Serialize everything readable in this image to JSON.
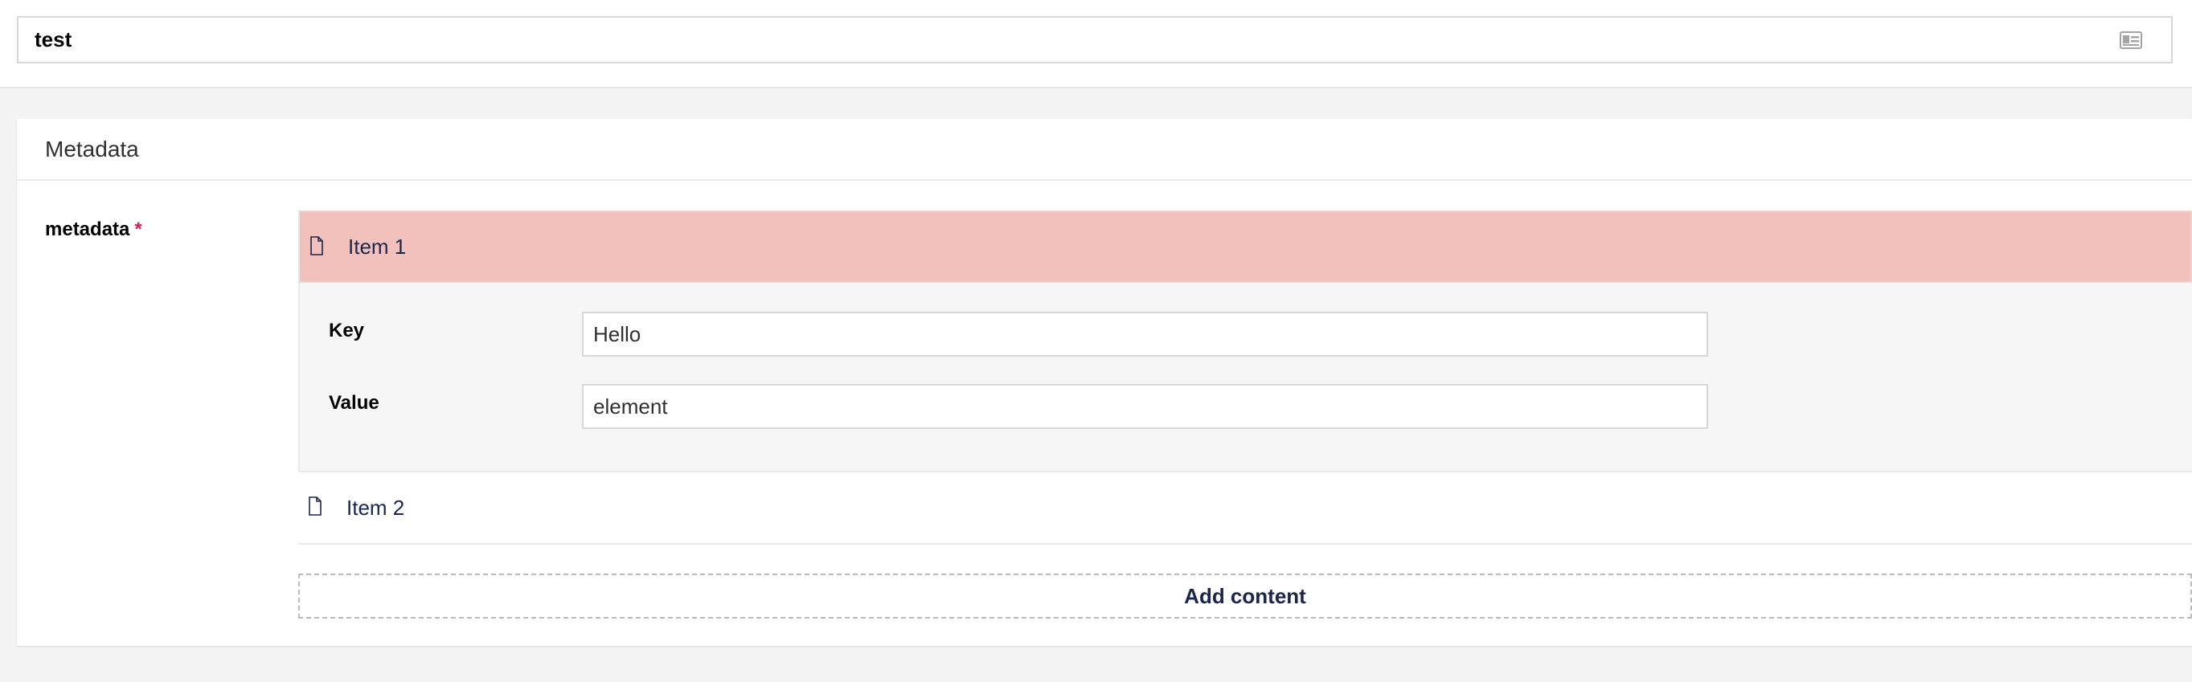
{
  "name_field": {
    "value": "test",
    "icon": "id-card-icon"
  },
  "panel": {
    "title": "Metadata",
    "field_label": "metadata",
    "required_mark": "*",
    "items": [
      {
        "label": "Item 1",
        "icon": "document-icon",
        "active": true
      },
      {
        "label": "Item 2",
        "icon": "document-icon",
        "active": false
      }
    ],
    "expanded": {
      "key_label": "Key",
      "key_value": "Hello",
      "value_label": "Value",
      "value_value": "element"
    },
    "add_content_label": "Add content"
  },
  "colors": {
    "active_row": "#f3c1bc",
    "required": "#d42054",
    "text_primary": "#1b264f",
    "background": "#f4f3f3"
  }
}
